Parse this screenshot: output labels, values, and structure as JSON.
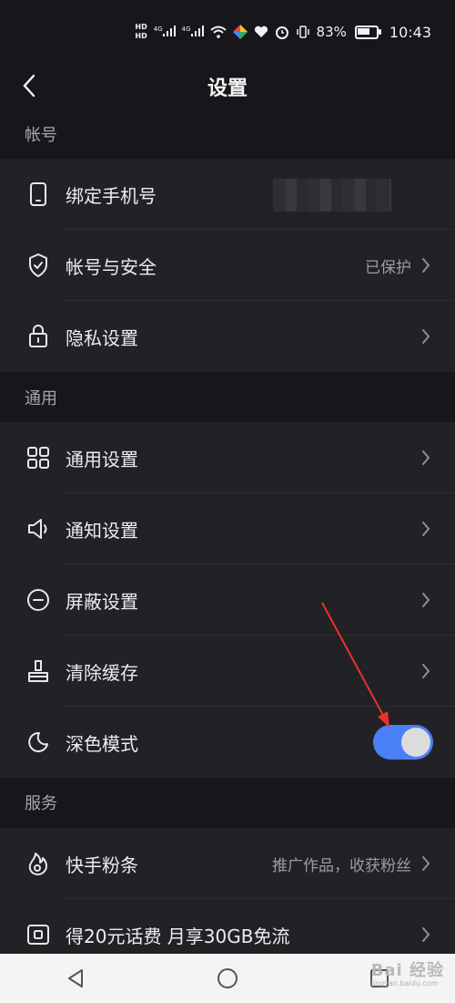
{
  "status_bar": {
    "network_left": "HD",
    "network_left2": "HD",
    "signal1": "4G",
    "signal2": "4G",
    "battery_percent": "83%",
    "battery_level": 0.83,
    "time": "10:43",
    "icons": [
      "signal-icon",
      "signal-icon",
      "wifi-icon",
      "app-icon",
      "heart-icon",
      "alarm-icon",
      "vibrate-icon",
      "battery-icon"
    ]
  },
  "header": {
    "title": "设置",
    "back_icon": "chevron-left-icon"
  },
  "sections": [
    {
      "label": "帐号"
    },
    {
      "label": "通用"
    },
    {
      "label": "服务"
    }
  ],
  "rows": {
    "bind_phone": {
      "label": "绑定手机号",
      "icon": "phone-icon"
    },
    "account_security": {
      "label": "帐号与安全",
      "value": "已保护",
      "icon": "shield-icon"
    },
    "privacy": {
      "label": "隐私设置",
      "icon": "lock-icon"
    },
    "general": {
      "label": "通用设置",
      "icon": "grid-icon"
    },
    "notify": {
      "label": "通知设置",
      "icon": "speaker-icon"
    },
    "block": {
      "label": "屏蔽设置",
      "icon": "minus-circle-icon"
    },
    "cache": {
      "label": "清除缓存",
      "icon": "brush-icon"
    },
    "dark": {
      "label": "深色模式",
      "icon": "moon-icon",
      "enabled": true
    },
    "fans": {
      "label": "快手粉条",
      "value": "推广作品，收获粉丝",
      "icon": "fire-icon"
    },
    "data": {
      "label": "得20元话费 月享30GB免流",
      "icon": "sim-icon"
    }
  },
  "colors": {
    "accent": "#4a80f5",
    "background": "#17171b",
    "row": "#222226",
    "annotation": "#e8322b"
  },
  "nav": {
    "icons": [
      "back-triangle-icon",
      "home-circle-icon",
      "recent-square-icon"
    ]
  },
  "watermark": {
    "text": "Bai 经验",
    "sub": "jingyan.baidu.com"
  }
}
